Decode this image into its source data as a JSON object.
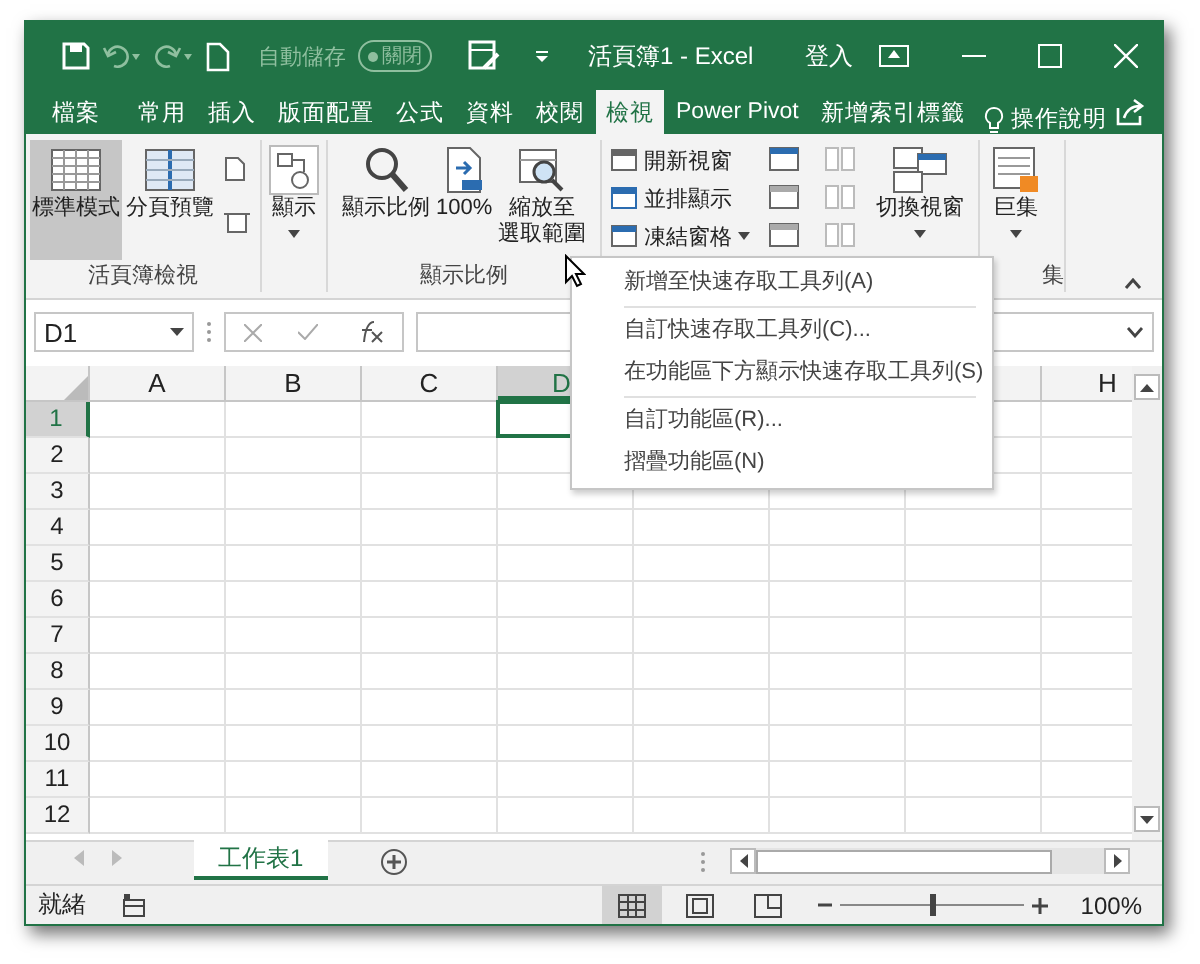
{
  "title_bar": {
    "autosave": {
      "label": "自動儲存",
      "state": "關閉",
      "on": false
    },
    "title": "活頁簿1 - Excel",
    "sign_in": "登入"
  },
  "tabs": [
    {
      "label": "檔案",
      "selected": false
    },
    {
      "label": "常用",
      "selected": false
    },
    {
      "label": "插入",
      "selected": false
    },
    {
      "label": "版面配置",
      "selected": false
    },
    {
      "label": "公式",
      "selected": false
    },
    {
      "label": "資料",
      "selected": false
    },
    {
      "label": "校閱",
      "selected": false
    },
    {
      "label": "檢視",
      "selected": true
    },
    {
      "label": "Power Pivot",
      "selected": false
    },
    {
      "label": "新增索引標籤",
      "selected": false
    }
  ],
  "tell_me": "操作說明",
  "ribbon": {
    "groups": [
      {
        "label": "活頁簿檢視",
        "items": [
          {
            "kind": "large",
            "label": "標準模式",
            "selected": true
          },
          {
            "kind": "large",
            "label": "分頁預覽",
            "selected": false
          },
          {
            "kind": "icons"
          }
        ]
      },
      {
        "items": [
          {
            "kind": "large",
            "label": "顯示",
            "dropdown": true
          }
        ]
      },
      {
        "label": "顯示比例",
        "items": [
          {
            "kind": "large",
            "label": "顯示比例"
          },
          {
            "kind": "large",
            "label": "100%"
          },
          {
            "kind": "large",
            "lines": [
              "縮放至",
              "選取範圍"
            ]
          }
        ]
      },
      {
        "items": [
          {
            "kind": "smalls",
            "entries": [
              {
                "label": "開新視窗"
              },
              {
                "label": "並排顯示"
              },
              {
                "label": "凍結窗格",
                "dropdown": true
              }
            ]
          },
          {
            "kind": "icons"
          },
          {
            "kind": "large",
            "label": "切換視窗",
            "dropdown": true
          }
        ]
      },
      {
        "label": "集",
        "items": [
          {
            "kind": "large",
            "label": "巨集",
            "dropdown": true
          }
        ]
      }
    ]
  },
  "formula_bar": {
    "name_box": "D1"
  },
  "grid": {
    "columns": [
      {
        "label": "A",
        "selected": false
      },
      {
        "label": "B",
        "selected": false
      },
      {
        "label": "C",
        "selected": false
      },
      {
        "label": "D",
        "selected": true
      }
    ],
    "last_column": "H",
    "rows": [
      {
        "label": "1",
        "selected": true
      },
      {
        "label": "2",
        "selected": false
      },
      {
        "label": "3",
        "selected": false
      },
      {
        "label": "4",
        "selected": false
      },
      {
        "label": "5",
        "selected": false
      },
      {
        "label": "6",
        "selected": false
      },
      {
        "label": "7",
        "selected": false
      },
      {
        "label": "8",
        "selected": false
      },
      {
        "label": "9",
        "selected": false
      },
      {
        "label": "10",
        "selected": false
      },
      {
        "label": "11",
        "selected": false
      },
      {
        "label": "12",
        "selected": false
      }
    ]
  },
  "sheets": [
    {
      "label": "工作表1",
      "selected": true
    }
  ],
  "status_bar": {
    "status": "就緒",
    "view_modes": [
      {
        "selected": true
      },
      {
        "selected": false
      },
      {
        "selected": false
      }
    ],
    "zoom_slider": {
      "level": 0.5
    },
    "zoom": "100%"
  },
  "context_menu": {
    "sections": [
      [
        {
          "label": "新增至快速存取工具列(A)"
        }
      ],
      [
        {
          "label": "自訂快速存取工具列(C)..."
        },
        {
          "label": "在功能區下方顯示快速存取工具列(S)"
        }
      ],
      [
        {
          "label": "自訂功能區(R)..."
        },
        {
          "label": "摺疊功能區(N)"
        }
      ]
    ]
  }
}
